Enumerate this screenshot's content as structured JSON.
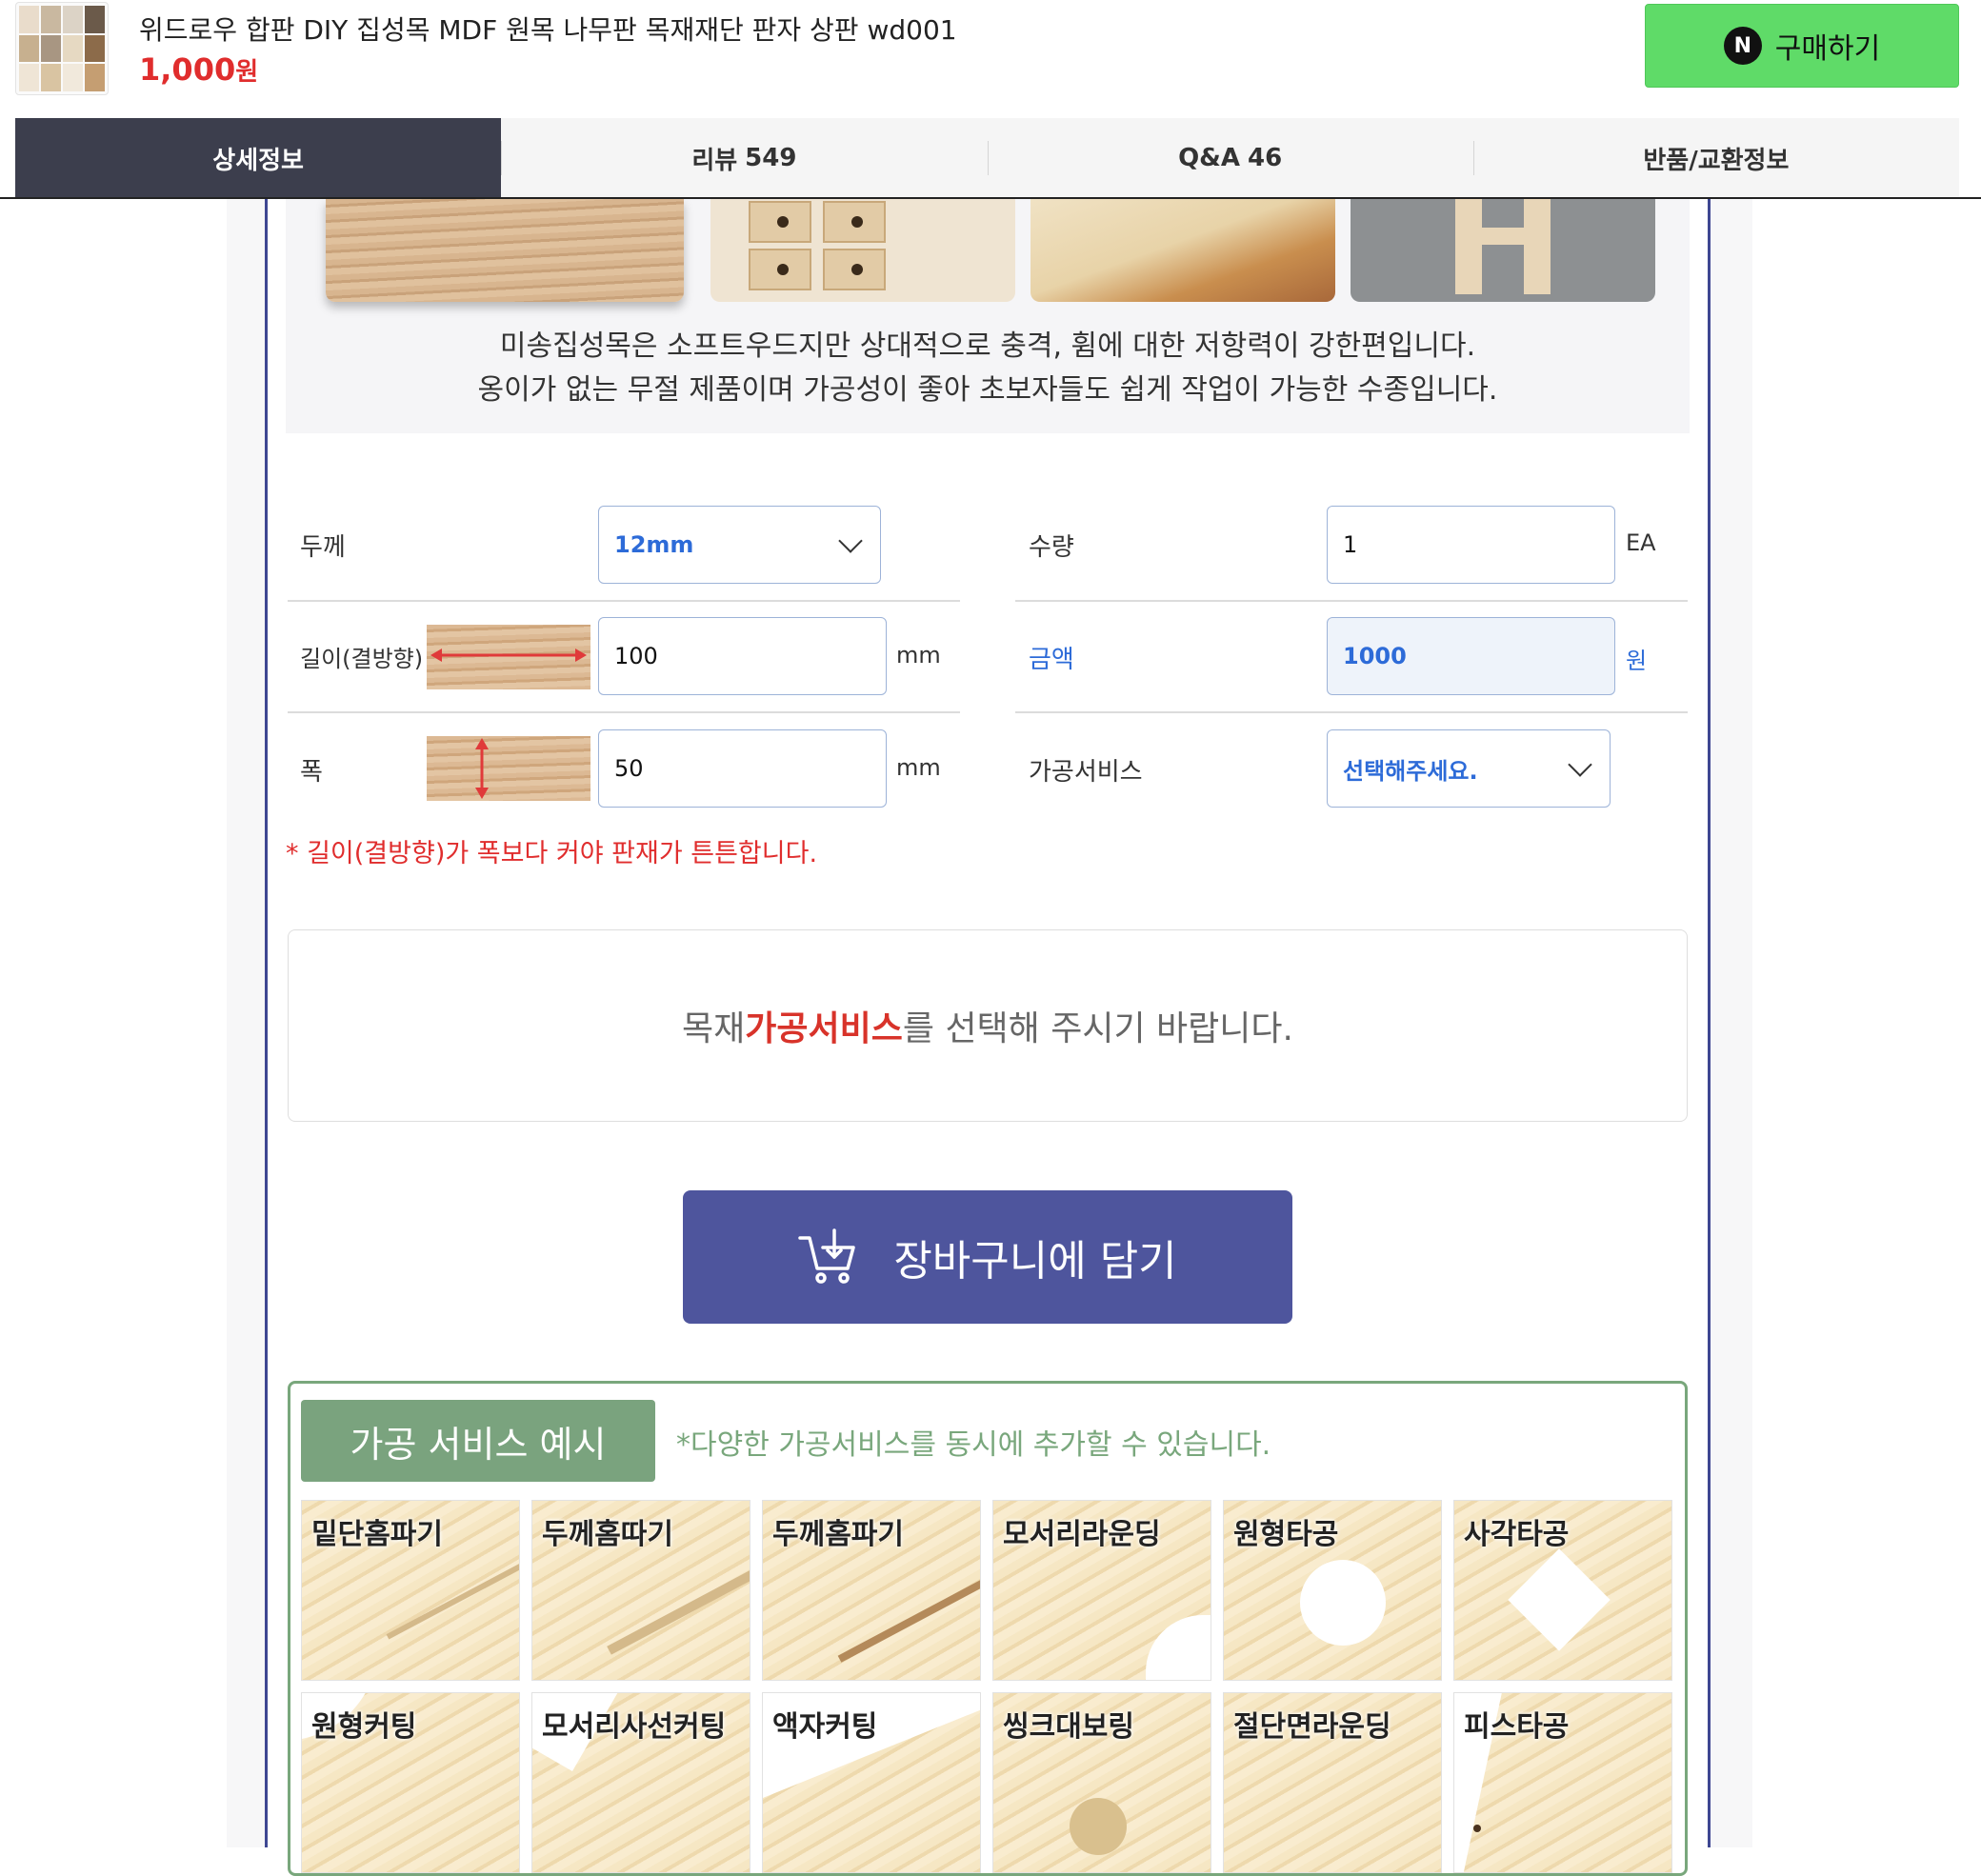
{
  "header": {
    "product_title": "위드로우 합판 DIY 집성목 MDF 원목 나무판 목재재단 판자 상판 wd001",
    "price": "1,000",
    "price_unit": "원",
    "buy_button": {
      "icon_letter": "N",
      "label": "구매하기"
    }
  },
  "tabs": [
    {
      "label": "상세정보",
      "count": ""
    },
    {
      "label": "리뷰",
      "count": "549"
    },
    {
      "label": "Q&A",
      "count": "46"
    },
    {
      "label": "반품/교환정보",
      "count": ""
    }
  ],
  "intro": {
    "line1": "미송집성목은 소프트우드지만 상대적으로 충격, 휨에 대한 저항력이 강한편입니다.",
    "line2": "옹이가 없는 무절 제품이며 가공성이 좋아 초보자들도 쉽게 작업이 가능한 수종입니다."
  },
  "form": {
    "thickness": {
      "label": "두께",
      "value": "12mm"
    },
    "quantity": {
      "label": "수량",
      "value": "1",
      "unit": "EA"
    },
    "length": {
      "label": "길이(결방향)",
      "value": "100",
      "unit": "mm"
    },
    "price": {
      "label": "금액",
      "value": "1000",
      "unit": "원"
    },
    "width": {
      "label": "폭",
      "value": "50",
      "unit": "mm"
    },
    "service": {
      "label": "가공서비스",
      "placeholder": "선택해주세요."
    },
    "notice": "* 길이(결방향)가 폭보다 커야 판재가 튼튼합니다."
  },
  "service_message": {
    "before": "목재 ",
    "highlight": "가공서비스",
    "after": "를 선택해 주시기 바랍니다."
  },
  "cart_button": "장바구니에 담기",
  "service_examples": {
    "title": "가공 서비스 예시",
    "subtitle": "*다양한 가공서비스를 동시에 추가할 수 있습니다.",
    "items": [
      "밑단홈파기",
      "두께홈따기",
      "두께홈파기",
      "모서리라운딩",
      "원형타공",
      "사각타공",
      "원형커팅",
      "모서리사선커팅",
      "액자커팅",
      "씽크대보링",
      "절단면라운딩",
      "피스타공"
    ]
  },
  "colors": {
    "accent_navy": "#4e559d",
    "tab_active": "#3c3e4d",
    "buy_green": "#5fdb68",
    "price_red": "#e02d2d",
    "service_green": "#7aa37e",
    "link_blue": "#2d6bd8"
  }
}
